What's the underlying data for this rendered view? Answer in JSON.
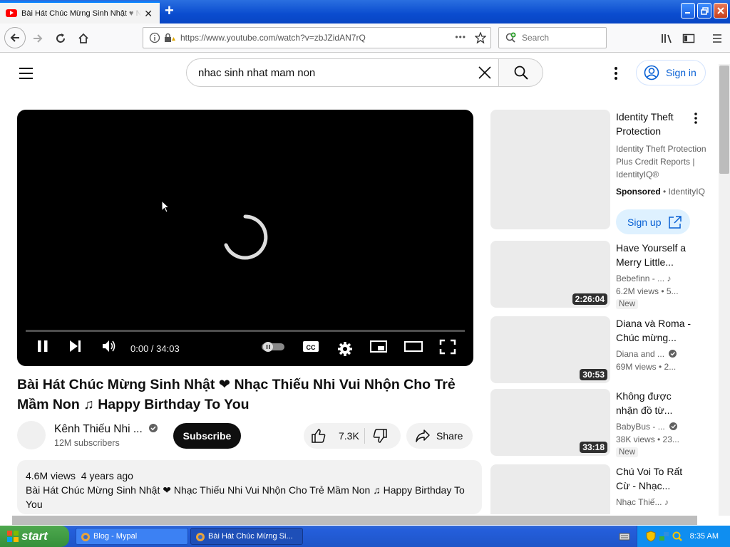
{
  "browser": {
    "tab_title": "Bài Hát Chúc Mừng Sinh Nhật ♥ Nhạc Thiếu Nhi Vui Nhộn Cho Trẻ Mầm Non",
    "tab_close": "✕",
    "new_tab": "+",
    "url": "https://www.youtube.com/watch?v=zbJZidAN7rQ",
    "search_placeholder": "Search",
    "url_more": "•••"
  },
  "yt_header": {
    "search_value": "nhac sinh nhat mam non",
    "sign_in_label": "Sign in"
  },
  "player": {
    "time": "0:00 / 34:03"
  },
  "video": {
    "title": "Bài Hát Chúc Mừng Sinh Nhật ❤ Nhạc Thiếu Nhi Vui Nhộn Cho Trẻ Mầm Non ♫ Happy Birthday To You",
    "channel": "Kênh Thiếu Nhi ...",
    "subscribers": "12M subscribers",
    "subscribe_label": "Subscribe",
    "likes": "7.3K",
    "share_label": "Share",
    "views_age": "4.6M views  4 years ago",
    "description": "Bài Hát Chúc Mừng Sinh Nhật ❤ Nhạc Thiếu Nhi Vui Nhộn Cho Trẻ Mầm Non ♫ Happy Birthday To You"
  },
  "ad": {
    "title": "Identity Theft Protection",
    "description": "Identity Theft Protection Plus Credit Reports | IdentityIQ®",
    "sponsored": "Sponsored",
    "advertiser": "• IdentityIQ",
    "cta": "Sign up"
  },
  "related": [
    {
      "title": "Have Yourself a Merry Little...",
      "channel": "Bebefinn - ...",
      "meta": "6.2M views  • 5...",
      "duration": "2:26:04",
      "badge": "New"
    },
    {
      "title": "Diana và Roma - Chúc mừng...",
      "channel": "Diana and ...",
      "meta": "69M views  • 2...",
      "duration": "30:53",
      "badge": ""
    },
    {
      "title": "Không được nhận đồ từ...",
      "channel": "BabyBus - ...",
      "meta": "38K views  • 23...",
      "duration": "33:18",
      "badge": "New"
    },
    {
      "title": "Chú Voi To Rất Cừ - Nhạc...",
      "channel": "Nhạc Thiế...",
      "meta": "",
      "duration": "",
      "badge": ""
    }
  ],
  "taskbar": {
    "start": "start",
    "tasks": [
      "Blog - Mypal",
      "Bài Hát Chúc Mừng Si..."
    ],
    "clock": "8:35 AM"
  },
  "colors": {
    "yt_red": "#ff0000",
    "link_blue": "#065fd4",
    "xp_blue": "#245edb",
    "xp_green": "#35903a"
  }
}
